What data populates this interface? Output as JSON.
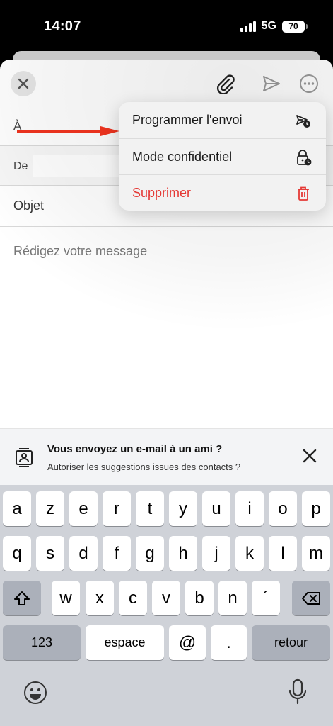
{
  "status_bar": {
    "time": "14:07",
    "network": "5G",
    "battery": "70"
  },
  "compose": {
    "to_label": "À",
    "from_label": "De",
    "subject_label": "Objet",
    "body_placeholder": "Rédigez votre message"
  },
  "menu": {
    "items": [
      {
        "label": "Programmer l'envoi",
        "icon": "schedule-send-icon"
      },
      {
        "label": "Mode confidentiel",
        "icon": "lock-clock-icon"
      },
      {
        "label": "Supprimer",
        "icon": "trash-icon"
      }
    ]
  },
  "suggestion": {
    "title": "Vous envoyez un e-mail à un ami ?",
    "subtitle": "Autoriser les suggestions issues des contacts ?"
  },
  "keyboard": {
    "row1": [
      "a",
      "z",
      "e",
      "r",
      "t",
      "y",
      "u",
      "i",
      "o",
      "p"
    ],
    "row2": [
      "q",
      "s",
      "d",
      "f",
      "g",
      "h",
      "j",
      "k",
      "l",
      "m"
    ],
    "row3": [
      "w",
      "x",
      "c",
      "v",
      "b",
      "n",
      "´"
    ],
    "numbers": "123",
    "space": "espace",
    "at": "@",
    "dot": ".",
    "return": "retour"
  },
  "colors": {
    "accent_red": "#e53935",
    "arrow_red": "#e8321e"
  }
}
